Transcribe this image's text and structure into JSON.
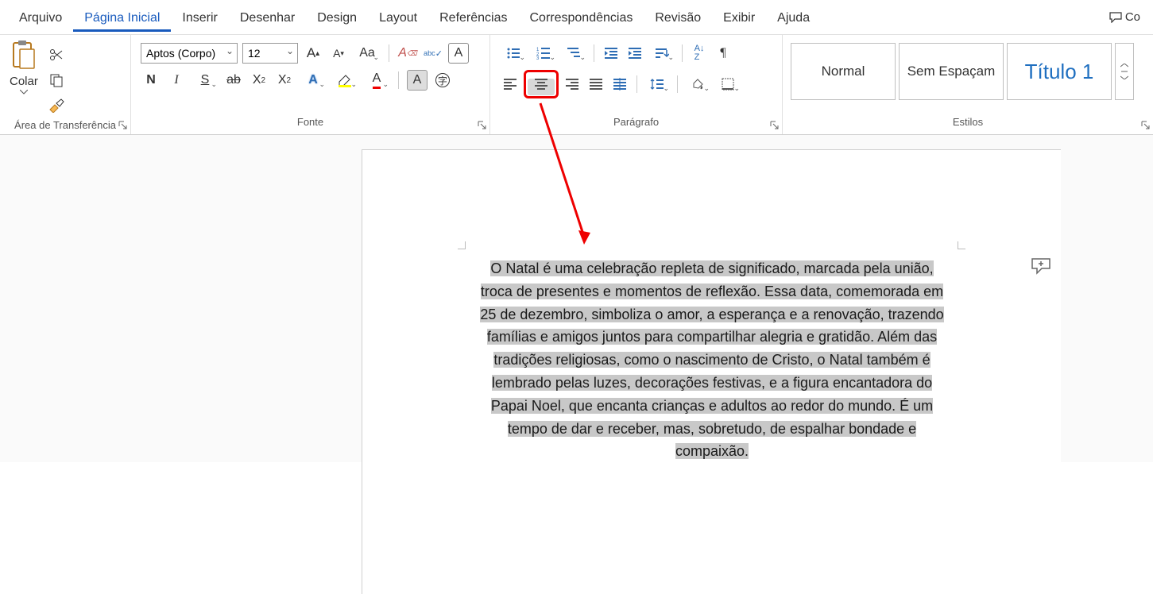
{
  "tabs": {
    "arquivo": "Arquivo",
    "pagina_inicial": "Página Inicial",
    "inserir": "Inserir",
    "desenhar": "Desenhar",
    "design": "Design",
    "layout": "Layout",
    "referencias": "Referências",
    "correspondencias": "Correspondências",
    "revisao": "Revisão",
    "exibir": "Exibir",
    "ajuda": "Ajuda",
    "comentarios": "Co"
  },
  "clipboard": {
    "colar": "Colar",
    "group_label": "Área de Transferência"
  },
  "font": {
    "family": "Aptos (Corpo)",
    "size": "12",
    "group_label": "Fonte"
  },
  "paragraph": {
    "group_label": "Parágrafo"
  },
  "styles": {
    "normal": "Normal",
    "no_spacing": "Sem Espaçam",
    "title1": "Título 1",
    "group_label": "Estilos"
  },
  "document": {
    "text": "O Natal é uma celebração repleta de significado, marcada pela união, troca de presentes e momentos de reflexão. Essa data, comemorada em 25 de dezembro, simboliza o amor, a esperança e a renovação, trazendo famílias e amigos juntos para compartilhar alegria e gratidão. Além das tradições religiosas, como o nascimento de Cristo, o Natal também é lembrado pelas luzes, decorações festivas, e a figura encantadora do Papai Noel, que encanta crianças e adultos ao redor do mundo. É um tempo de dar e receber, mas, sobretudo, de espalhar bondade e compaixão."
  }
}
